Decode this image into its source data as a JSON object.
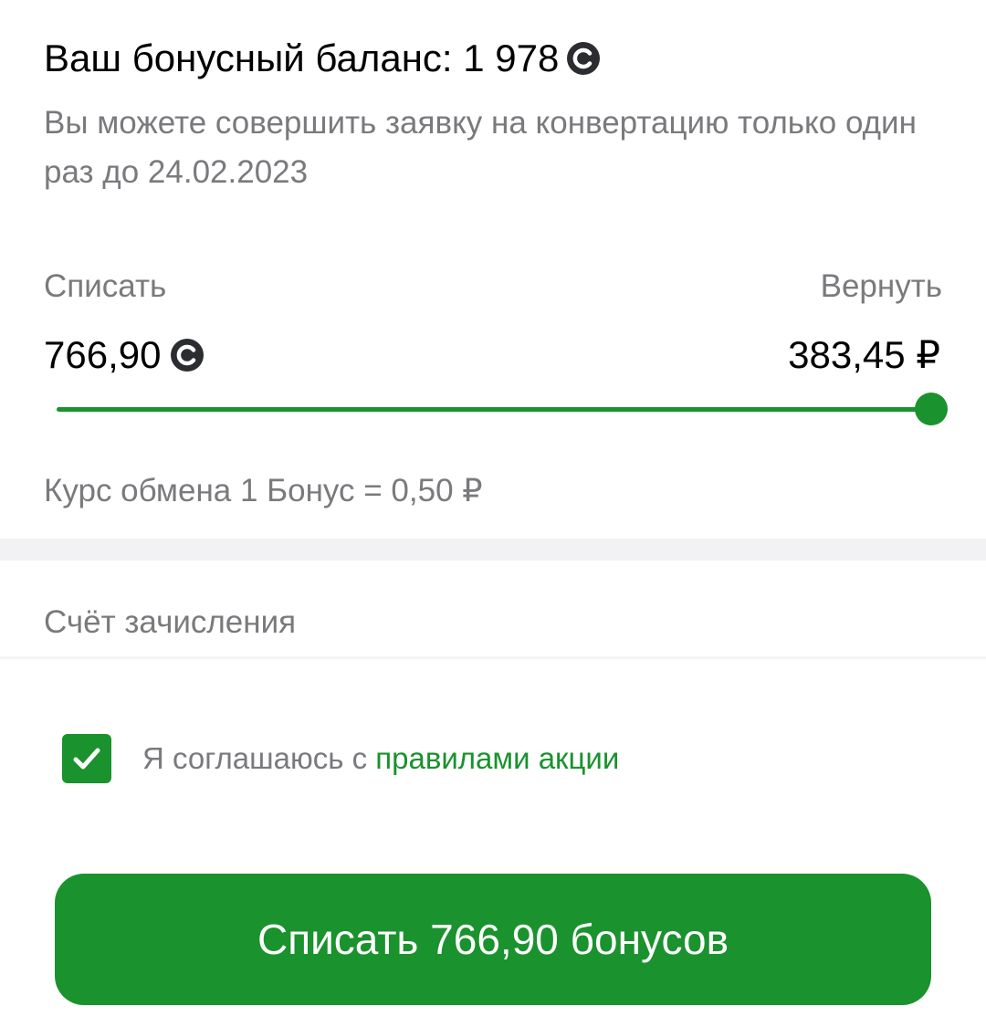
{
  "balance": {
    "label": "Ваш бонусный баланс: 1 978",
    "coin_icon": "sber-spasibo-coin-icon"
  },
  "notice": "Вы можете совершить заявку на конвертацию только один раз до 24.02.2023",
  "conversion": {
    "debit_label": "Списать",
    "refund_label": "Вернуть",
    "debit_value": "766,90",
    "refund_value": "383,45 ₽",
    "slider_fraction": 1.0
  },
  "rate_text": "Курс обмена 1 Бонус = 0,50 ₽",
  "account_label": "Счёт зачисления",
  "agreement": {
    "checked": true,
    "text": "Я соглашаюсь с ",
    "link_text": "правилами акции"
  },
  "submit_button_label": "Списать 766,90 бонусов",
  "colors": {
    "accent": "#1a922d",
    "secondary_text": "#7a7a7e",
    "coin_bg": "#2b2d31"
  }
}
